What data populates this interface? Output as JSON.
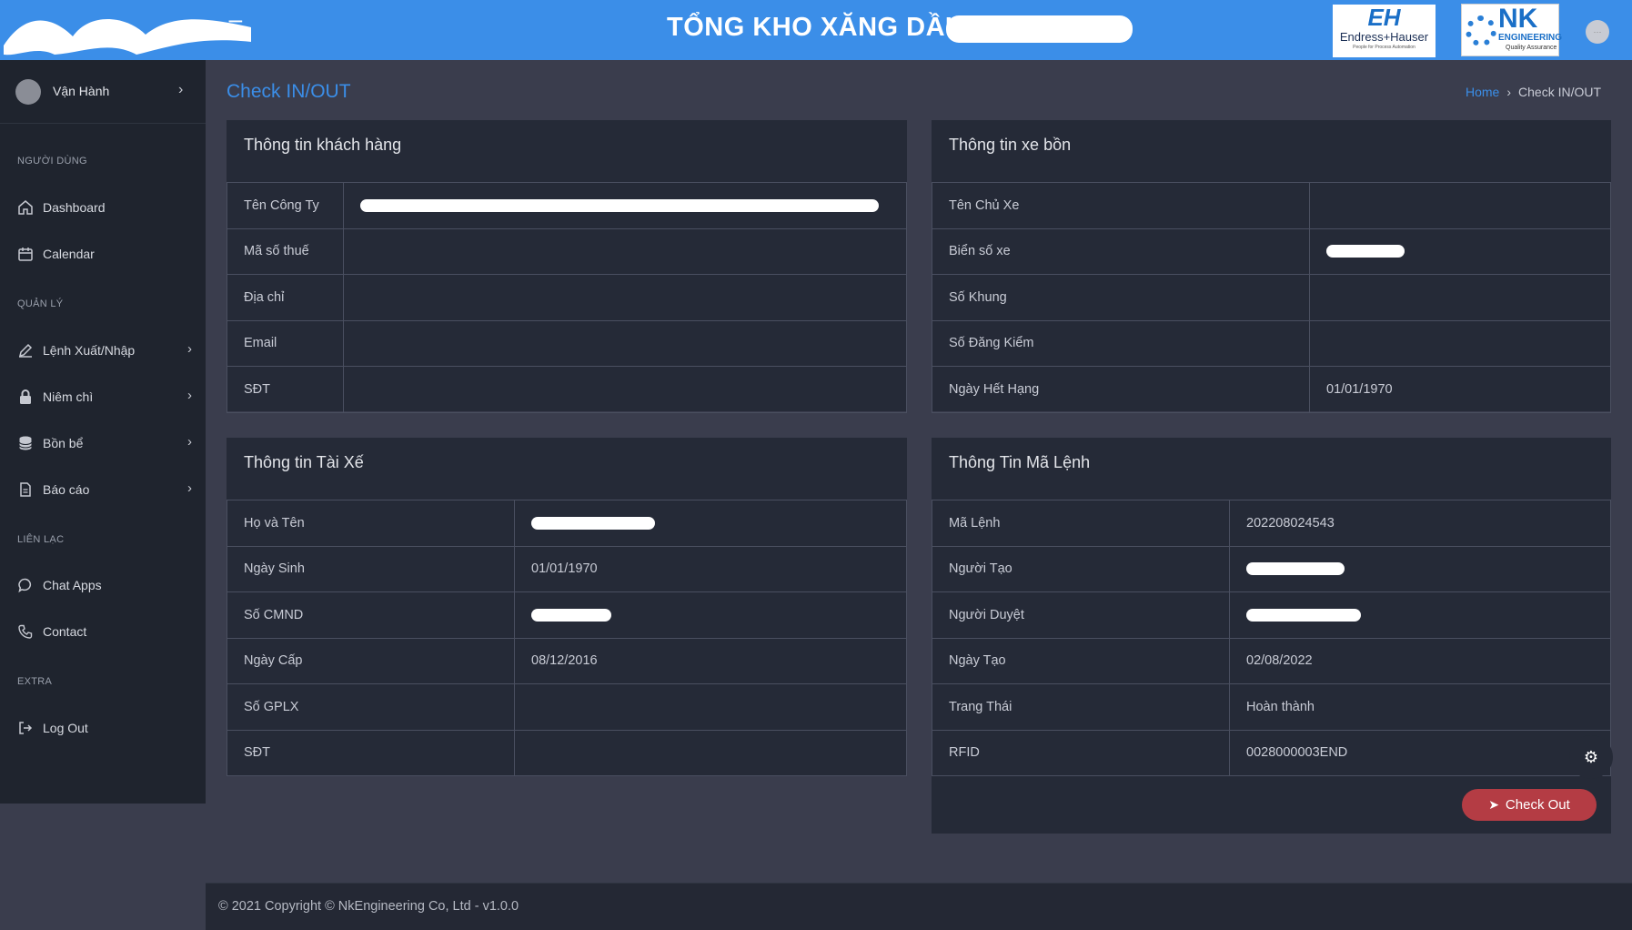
{
  "header": {
    "title": "TỔNG KHO XĂNG DẦU",
    "menu_icon": "hamburger-icon",
    "logo_eh": {
      "mark": "EH",
      "name": "Endress+Hauser",
      "tagline": "People for Process Automation"
    },
    "logo_nk": {
      "mark": "NK",
      "name": "ENGINEERING",
      "tagline": "Quality Assurance"
    }
  },
  "sidebar": {
    "user": {
      "name": "Vận Hành"
    },
    "sections": [
      {
        "label": "NGƯỜI DÙNG"
      },
      {
        "label": "QUẢN LÝ"
      },
      {
        "label": "LIÊN LẠC"
      },
      {
        "label": "EXTRA"
      }
    ],
    "items": [
      {
        "label": "Dashboard",
        "icon": "home-icon"
      },
      {
        "label": "Calendar",
        "icon": "calendar-icon"
      },
      {
        "label": "Lệnh Xuất/Nhập",
        "icon": "pencil-icon"
      },
      {
        "label": "Niêm chì",
        "icon": "lock-icon"
      },
      {
        "label": "Bồn bể",
        "icon": "database-icon"
      },
      {
        "label": "Báo cáo",
        "icon": "document-icon"
      },
      {
        "label": "Chat Apps",
        "icon": "chat-icon"
      },
      {
        "label": "Contact",
        "icon": "phone-icon"
      },
      {
        "label": "Log Out",
        "icon": "logout-icon"
      }
    ]
  },
  "page": {
    "title": "Check IN/OUT",
    "breadcrumb": {
      "home": "Home",
      "current": "Check IN/OUT"
    }
  },
  "customer": {
    "title": "Thông tin khách hàng",
    "rows": [
      {
        "label": "Tên Công Ty",
        "value": ""
      },
      {
        "label": "Mã số thuế",
        "value": ""
      },
      {
        "label": "Địa chỉ",
        "value": ""
      },
      {
        "label": "Email",
        "value": ""
      },
      {
        "label": "SĐT",
        "value": ""
      }
    ]
  },
  "tanker": {
    "title": "Thông tin xe bồn",
    "rows": [
      {
        "label": "Tên Chủ Xe",
        "value": ""
      },
      {
        "label": "Biển số xe",
        "value": ""
      },
      {
        "label": "Số Khung",
        "value": ""
      },
      {
        "label": "Số Đăng Kiểm",
        "value": ""
      },
      {
        "label": "Ngày Hết Hạng",
        "value": "01/01/1970"
      }
    ]
  },
  "driver": {
    "title": "Thông tin Tài Xế",
    "rows": [
      {
        "label": "Họ và Tên",
        "value": ""
      },
      {
        "label": "Ngày Sinh",
        "value": "01/01/1970"
      },
      {
        "label": "Số CMND",
        "value": ""
      },
      {
        "label": "Ngày Cấp",
        "value": "08/12/2016"
      },
      {
        "label": "Số GPLX",
        "value": ""
      },
      {
        "label": "SĐT",
        "value": ""
      }
    ]
  },
  "order": {
    "title": "Thông Tin Mã Lệnh",
    "rows": [
      {
        "label": "Mã Lệnh",
        "value": "202208024543"
      },
      {
        "label": "Người Tạo",
        "value": ""
      },
      {
        "label": "Người Duyệt",
        "value": ""
      },
      {
        "label": "Ngày Tạo",
        "value": "02/08/2022"
      },
      {
        "label": "Trang Thái",
        "value": "Hoàn thành"
      },
      {
        "label": "RFID",
        "value": "0028000003END"
      }
    ],
    "checkout_label": "Check Out",
    "checkout_icon": "send-icon"
  },
  "settings_icon": "gear-icon",
  "footer": {
    "text": "© 2021 Copyright © NkEngineering Co, Ltd - v1.0.0"
  },
  "colors": {
    "accent": "#3b8ee8",
    "topbar": "#3b8ee8",
    "sidebar": "#1f242e",
    "card": "#252a37",
    "danger": "#b43c44"
  }
}
